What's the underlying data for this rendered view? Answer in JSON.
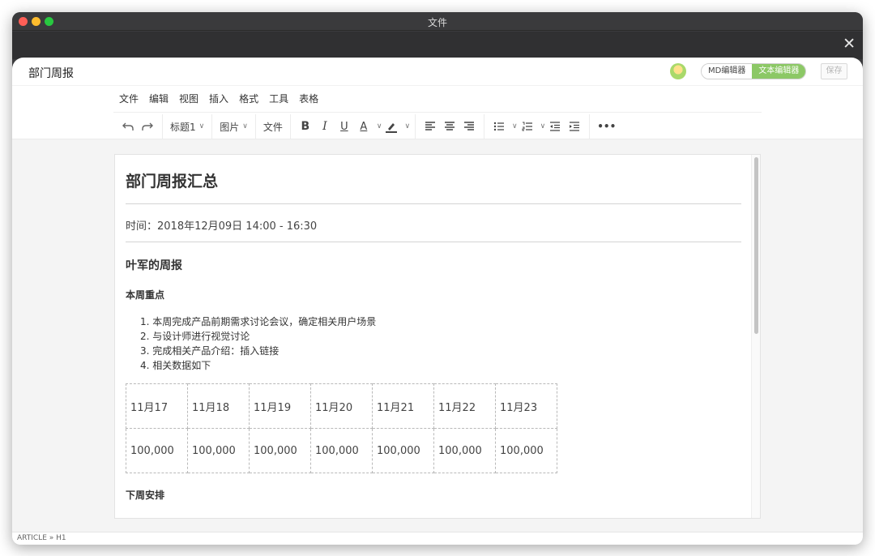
{
  "window": {
    "title": "文件"
  },
  "doc_header": {
    "title": "部门周报",
    "mode_md": "MD编辑器",
    "mode_text": "文本编辑器",
    "save_label": "保存"
  },
  "menu": {
    "items": [
      "文件",
      "编辑",
      "视图",
      "插入",
      "格式",
      "工具",
      "表格"
    ]
  },
  "toolbar": {
    "heading_label": "标题1",
    "image_label": "图片",
    "file_label": "文件",
    "bold": "B",
    "italic": "I",
    "underline": "U",
    "font_color": "A",
    "more": "•••"
  },
  "document": {
    "h1": "部门周报汇总",
    "meta": "时间：2018年12月09日  14:00 - 16:30",
    "h2": "叶军的周报",
    "section_this_week": "本周重点",
    "list_items": [
      "1. 本周完成产品前期需求讨论会议，确定相关用户场景",
      "2. 与设计师进行视觉讨论",
      "3. 完成相关产品介绍：插入链接",
      "4. 相关数据如下"
    ],
    "table": {
      "header": [
        "11月17",
        "11月18",
        "11月19",
        "11月20",
        "11月21",
        "11月22",
        "11月23"
      ],
      "values": [
        "100,000",
        "100,000",
        "100,000",
        "100,000",
        "100,000",
        "100,000",
        "100,000"
      ]
    },
    "section_next_week": "下周安排"
  },
  "statusbar": {
    "path": "ARTICLE » H1"
  }
}
